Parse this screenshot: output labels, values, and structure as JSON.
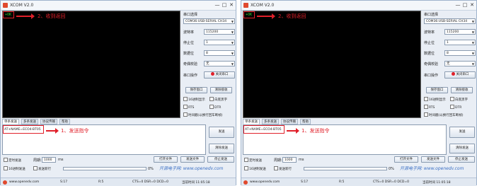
{
  "window": {
    "title": "XCOM V2.0",
    "min_glyph": "—",
    "max_glyph": "□",
    "close_glyph": "✕"
  },
  "receive": {
    "left_text": "+OK",
    "right_text": "+OK"
  },
  "annotations": {
    "received": "2、收到返回",
    "send_cmd": "1、发送指令"
  },
  "panel": {
    "port_select_label": "串口选择",
    "port_value": "COM36:USB-SERIAL CH34",
    "baud_label": "波特率",
    "baud_value": "115200",
    "stop_label": "停止位",
    "stop_value": "1",
    "data_label": "数据位",
    "data_value": "8",
    "parity_label": "奇偶校验",
    "parity_value": "无",
    "op_label": "串口操作",
    "close_port": "关闭串口",
    "save_window": "保存窗口",
    "clear_receive": "清除接收",
    "hex_display": "16进制显示",
    "white_black": "白底黑字",
    "rts": "RTS",
    "dtr": "DTR",
    "timestamp": "时间戳(以换行回车断帧)"
  },
  "tabs": [
    "单条发送",
    "多条发送",
    "协议传输",
    "帮助"
  ],
  "send": {
    "text": "AT+NAME=ECO4-BT05",
    "send_button": "发送",
    "clear_send": "清除发送"
  },
  "bottom": {
    "timed_send": "定时发送",
    "period_label": "周期:",
    "period_value": "1000",
    "period_unit": "ms",
    "open_file": "打开文件",
    "send_file": "发送文件",
    "stop_send": "停止发送",
    "hex_send": "16进制发送",
    "newline": "发送新行",
    "progress": "0%",
    "watermark": "开源电子网: www.openedv.com"
  },
  "status": {
    "site": "www.openedv.com",
    "s_count": "S:17",
    "r_count": "R:5",
    "signals": "CTS=0 DSR=0 DCD=0",
    "time": "当前时间 11:05:18"
  },
  "colors": {
    "annotation": "#e0202a",
    "recv_text": "#2fd12f",
    "recv_bg": "#000000"
  }
}
